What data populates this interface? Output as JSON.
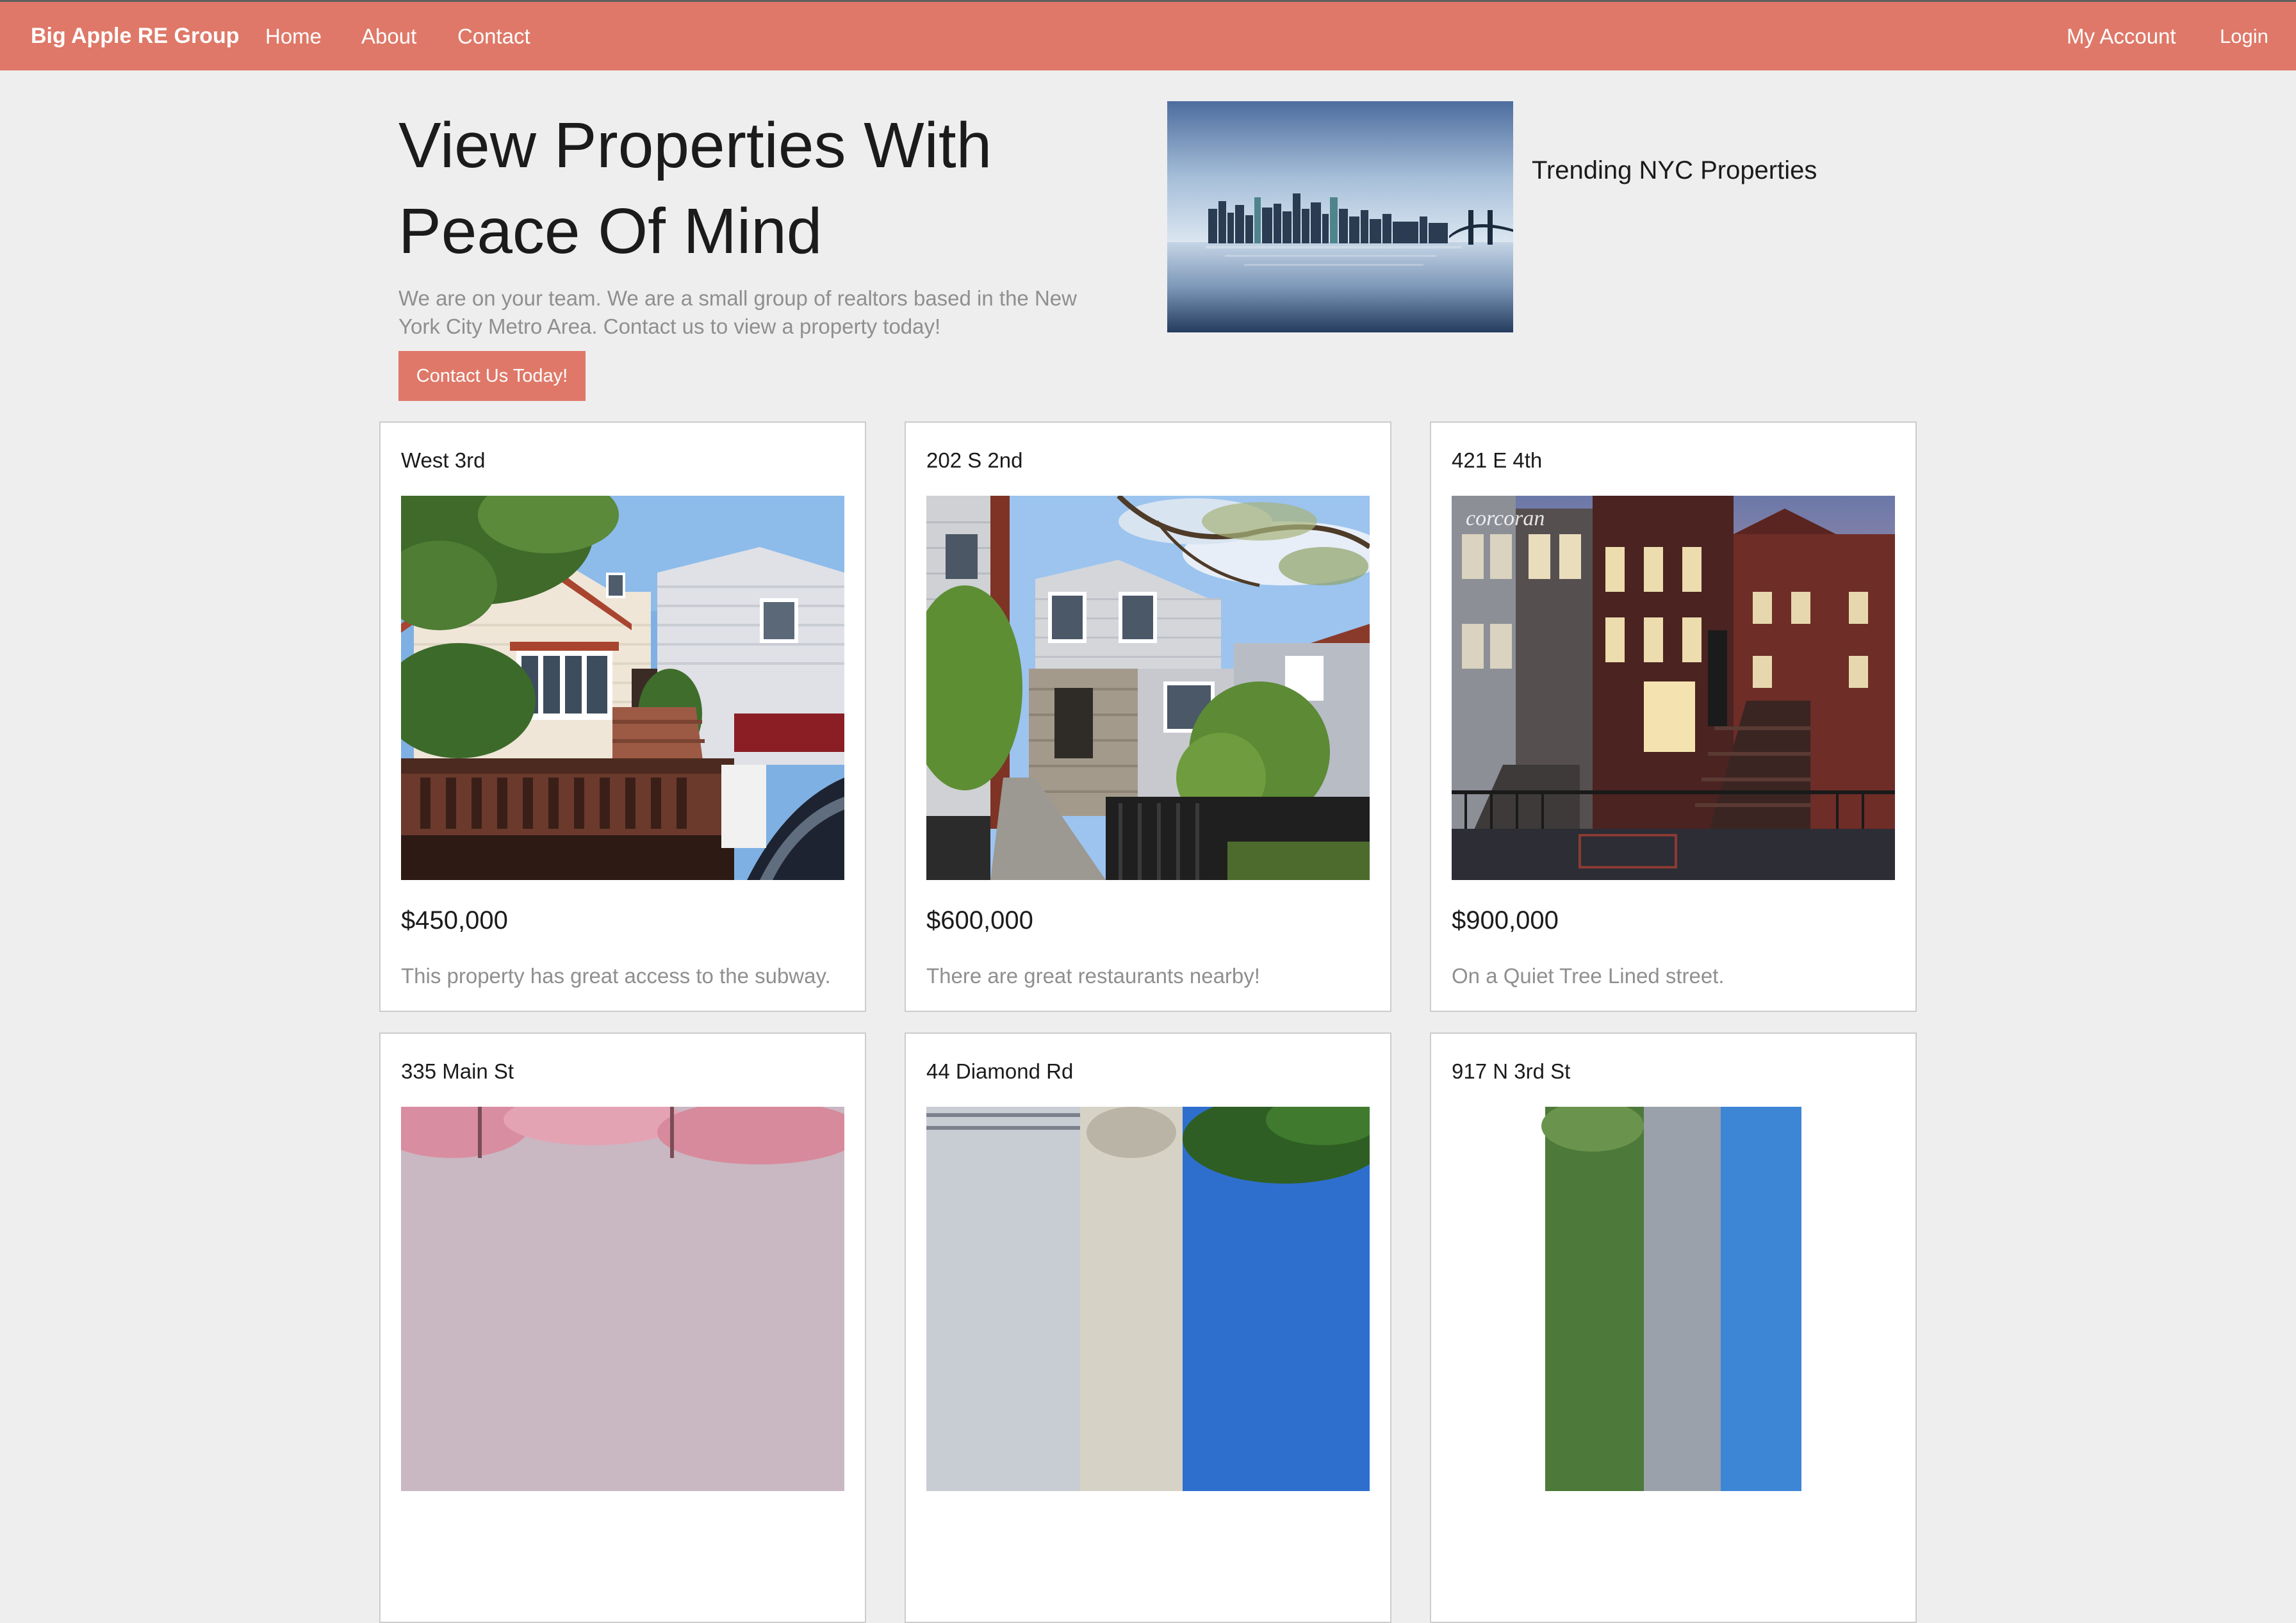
{
  "nav": {
    "brand": "Big Apple RE Group",
    "links": [
      "Home",
      "About",
      "Contact"
    ],
    "account": "My Account",
    "login": "Login"
  },
  "hero": {
    "title": "View Properties With Peace Of Mind",
    "text": "We are on your team. We are a small group of realtors based in the New York City Metro Area. Contact us to view a property today!",
    "button": "Contact Us Today!",
    "trending": "Trending NYC Properties"
  },
  "listings": [
    {
      "title": "West 3rd",
      "price": "$450,000",
      "description": "This property has great access to the subway.",
      "watermark": ""
    },
    {
      "title": "202 S 2nd",
      "price": "$600,000",
      "description": "There are great restaurants nearby!",
      "watermark": ""
    },
    {
      "title": "421 E 4th",
      "price": "$900,000",
      "description": "On a Quiet Tree Lined street.",
      "watermark": "corcoran"
    },
    {
      "title": "335 Main St",
      "price": "",
      "description": ""
    },
    {
      "title": "44 Diamond Rd",
      "price": "",
      "description": ""
    },
    {
      "title": "917 N 3rd St",
      "price": "",
      "description": ""
    }
  ],
  "colors": {
    "accent": "#df7868",
    "page_background": "#eeeeee",
    "muted_text": "#8f8f8f"
  }
}
